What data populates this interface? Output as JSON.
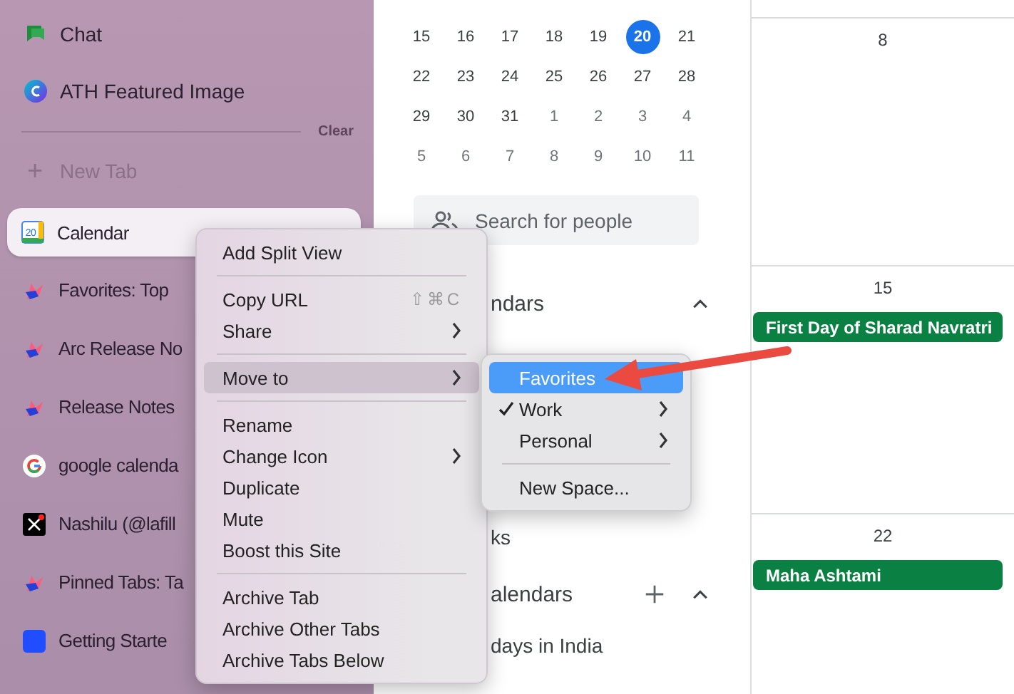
{
  "sidebar": {
    "pinned": [
      {
        "label": "Chat"
      },
      {
        "label": "ATH Featured Image"
      }
    ],
    "clear_label": "Clear",
    "new_tab": {
      "icon": "+",
      "label": "New Tab"
    },
    "tabs": [
      {
        "label": "Calendar",
        "selected": true,
        "icon_text": "20"
      },
      {
        "label": "Favorites: Top",
        "selected": false
      },
      {
        "label": "Arc Release No",
        "selected": false
      },
      {
        "label": "Release Notes",
        "selected": false
      },
      {
        "label": "google calenda",
        "selected": false
      },
      {
        "label": "Nashilu (@lafill",
        "selected": false
      },
      {
        "label": "Pinned Tabs: Ta",
        "selected": false
      },
      {
        "label": "Getting Starte",
        "selected": false
      }
    ]
  },
  "mini_calendar": {
    "weeks": [
      [
        {
          "day": "15",
          "muted": false,
          "selected": false
        },
        {
          "day": "16",
          "muted": false,
          "selected": false
        },
        {
          "day": "17",
          "muted": false,
          "selected": false
        },
        {
          "day": "18",
          "muted": false,
          "selected": false
        },
        {
          "day": "19",
          "muted": false,
          "selected": false
        },
        {
          "day": "20",
          "muted": false,
          "selected": true
        },
        {
          "day": "21",
          "muted": false,
          "selected": false
        }
      ],
      [
        {
          "day": "22",
          "muted": false,
          "selected": false
        },
        {
          "day": "23",
          "muted": false,
          "selected": false
        },
        {
          "day": "24",
          "muted": false,
          "selected": false
        },
        {
          "day": "25",
          "muted": false,
          "selected": false
        },
        {
          "day": "26",
          "muted": false,
          "selected": false
        },
        {
          "day": "27",
          "muted": false,
          "selected": false
        },
        {
          "day": "28",
          "muted": false,
          "selected": false
        }
      ],
      [
        {
          "day": "29",
          "muted": false,
          "selected": false
        },
        {
          "day": "30",
          "muted": false,
          "selected": false
        },
        {
          "day": "31",
          "muted": false,
          "selected": false
        },
        {
          "day": "1",
          "muted": true,
          "selected": false
        },
        {
          "day": "2",
          "muted": true,
          "selected": false
        },
        {
          "day": "3",
          "muted": true,
          "selected": false
        },
        {
          "day": "4",
          "muted": true,
          "selected": false
        }
      ],
      [
        {
          "day": "5",
          "muted": true,
          "selected": false
        },
        {
          "day": "6",
          "muted": true,
          "selected": false
        },
        {
          "day": "7",
          "muted": true,
          "selected": false
        },
        {
          "day": "8",
          "muted": true,
          "selected": false
        },
        {
          "day": "9",
          "muted": true,
          "selected": false
        },
        {
          "day": "10",
          "muted": true,
          "selected": false
        },
        {
          "day": "11",
          "muted": true,
          "selected": false
        }
      ]
    ]
  },
  "people_search": {
    "placeholder": "Search for people"
  },
  "calendar_sections": [
    {
      "kind": "heading",
      "label": "ndars",
      "add": false
    },
    {
      "kind": "item",
      "label": "ks"
    },
    {
      "kind": "heading",
      "label": "alendars",
      "add": true
    },
    {
      "kind": "item",
      "label": "days in India"
    }
  ],
  "month_cells": [
    {
      "day": "8"
    },
    {
      "day": "15",
      "events": [
        {
          "title": "First Day of Sharad Navratri",
          "color": "#0b8043"
        }
      ]
    },
    {
      "day": "22",
      "events": [
        {
          "title": "Maha Ashtami",
          "color": "#0b8043"
        }
      ]
    }
  ],
  "context_menu": {
    "groups": [
      [
        {
          "label": "Add Split View",
          "submenu": false,
          "selected": false
        }
      ],
      [
        {
          "label": "Copy URL",
          "shortcut": "⇧⌘C",
          "submenu": false,
          "selected": false
        },
        {
          "label": "Share",
          "submenu": true,
          "selected": false
        }
      ],
      [
        {
          "label": "Move to",
          "submenu": true,
          "selected": true
        }
      ],
      [
        {
          "label": "Rename",
          "submenu": false,
          "selected": false
        },
        {
          "label": "Change Icon",
          "submenu": true,
          "selected": false
        },
        {
          "label": "Duplicate",
          "submenu": false,
          "selected": false
        },
        {
          "label": "Mute",
          "submenu": false,
          "selected": false
        },
        {
          "label": "Boost this Site",
          "submenu": false,
          "selected": false
        }
      ],
      [
        {
          "label": "Archive Tab",
          "submenu": false,
          "selected": false
        },
        {
          "label": "Archive Other Tabs",
          "submenu": false,
          "selected": false
        },
        {
          "label": "Archive Tabs Below",
          "submenu": false,
          "selected": false
        }
      ]
    ]
  },
  "submenu": {
    "groups": [
      [
        {
          "label": "Favorites",
          "checked": false,
          "submenu": false,
          "selected": true
        },
        {
          "label": "Work",
          "checked": true,
          "submenu": true,
          "selected": false
        },
        {
          "label": "Personal",
          "checked": false,
          "submenu": true,
          "selected": false
        }
      ],
      [
        {
          "label": "New Space...",
          "checked": false,
          "submenu": false,
          "selected": false
        }
      ]
    ]
  }
}
